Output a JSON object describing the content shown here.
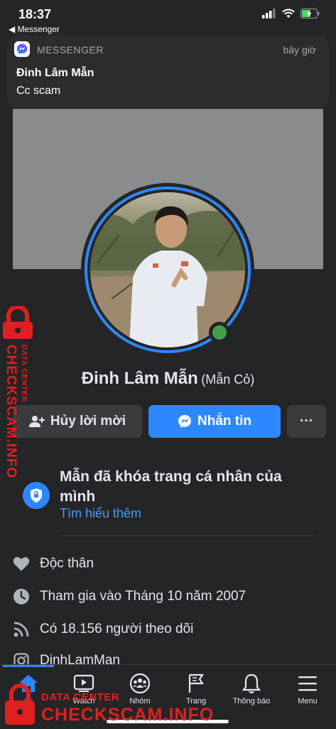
{
  "status_bar": {
    "time": "18:37",
    "back_app": "◀ Messenger"
  },
  "notification": {
    "app": "MESSENGER",
    "time": "bây giờ",
    "title": "Đinh Lâm Mẫn",
    "body": "Cc scam"
  },
  "profile": {
    "name": "Đinh Lâm Mẫn",
    "nickname": "(Mẫn Cỏ)",
    "online": true
  },
  "actions": {
    "cancel_request": "Hủy lời mời",
    "message": "Nhắn tin",
    "more": "···"
  },
  "lock_notice": {
    "text": "Mẫn đã khóa trang cá nhân của mình",
    "link": "Tìm hiểu thêm"
  },
  "info": [
    {
      "icon": "heart-icon",
      "text": "Độc thân"
    },
    {
      "icon": "clock-icon",
      "text": "Tham gia vào Tháng 10 năm 2007"
    },
    {
      "icon": "rss-icon",
      "text": "Có 18.156 người theo dõi"
    },
    {
      "icon": "instagram-icon",
      "text": "DinhLamMan"
    }
  ],
  "bottom_nav": [
    {
      "icon": "home-icon",
      "label": "tin"
    },
    {
      "icon": "watch-icon",
      "label": "Watch"
    },
    {
      "icon": "groups-icon",
      "label": "Nhóm"
    },
    {
      "icon": "pages-flag-icon",
      "label": "Trang"
    },
    {
      "icon": "bell-icon",
      "label": "Thông báo"
    },
    {
      "icon": "menu-icon",
      "label": "Menu"
    }
  ],
  "watermark": {
    "brand": "CHECKSCAM.INFO",
    "tag": "DATA CENTER"
  },
  "colors": {
    "background": "#242526",
    "accent": "#2d88ff",
    "online": "#44a046",
    "watermark": "#e02020"
  }
}
